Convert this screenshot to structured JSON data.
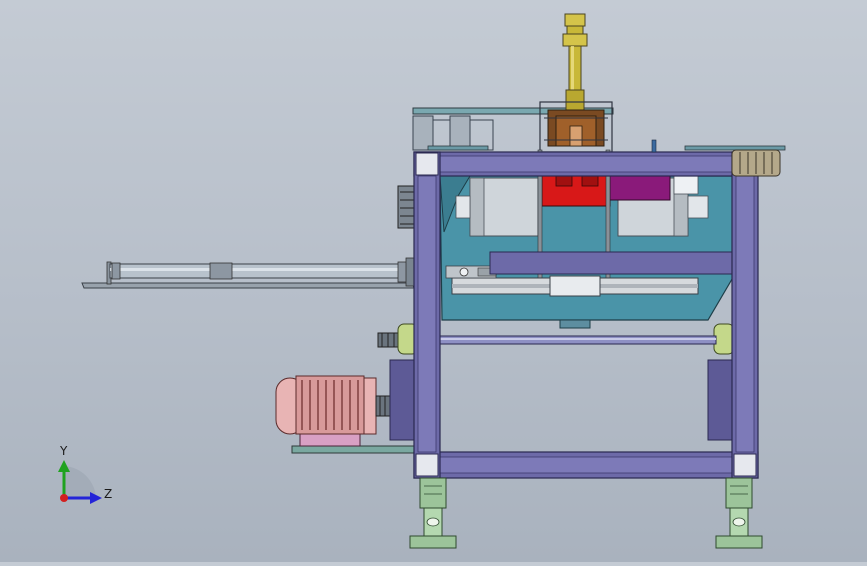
{
  "viewport": {
    "background_top": "#c4cbd4",
    "background_bottom": "#a9b2be"
  },
  "triad": {
    "y_label": "Y",
    "z_label": "Z",
    "y_color": "#1fa21f",
    "z_color": "#2424d8",
    "origin_color": "#d22020"
  },
  "colors": {
    "frame": "#6d6aa8",
    "frame_dark": "#3c3a6e",
    "cylinder": "#c8b838",
    "red_block": "#d81818",
    "magenta_block": "#8a1a7a",
    "teal_housing": "#4a94a8",
    "motor": "#e8b4b4",
    "feet": "#9cc49a",
    "steel": "#b8c0c8"
  }
}
